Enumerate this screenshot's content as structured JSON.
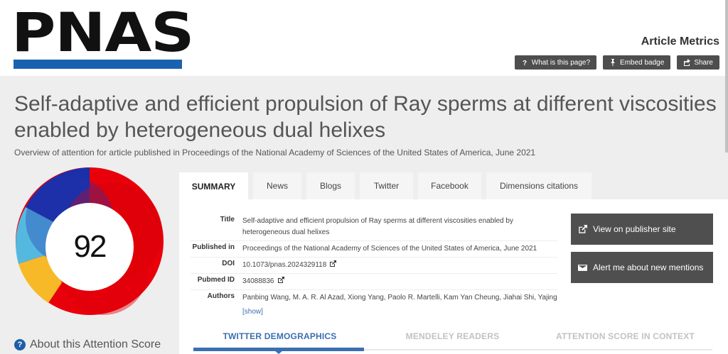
{
  "brand": {
    "logo_text": "PNAS",
    "accent": "#1a62b0"
  },
  "header": {
    "title": "Article Metrics",
    "buttons": [
      {
        "label": "What is this page?",
        "icon": "question-icon"
      },
      {
        "label": "Embed badge",
        "icon": "pin-icon"
      },
      {
        "label": "Share",
        "icon": "share-icon"
      }
    ]
  },
  "article": {
    "title": "Self-adaptive and efficient propulsion of Ray sperms at different viscosities enabled by heterogeneous dual helixes",
    "subtitle": "Overview of attention for article published in Proceedings of the National Academy of Sciences of the United States of America, June 2021"
  },
  "attention": {
    "score": "92",
    "about_label": "About this Attention Score",
    "donut_colors": [
      "#e8000b",
      "#1b2fa8",
      "#f7b928",
      "#55b9df"
    ]
  },
  "tabs": [
    {
      "label": "SUMMARY",
      "active": true
    },
    {
      "label": "News"
    },
    {
      "label": "Blogs"
    },
    {
      "label": "Twitter"
    },
    {
      "label": "Facebook"
    },
    {
      "label": "Dimensions citations"
    }
  ],
  "details": {
    "title_label": "Title",
    "title_value": "Self-adaptive and efficient propulsion of Ray sperms at different viscosities enabled by heterogeneous dual helixes",
    "published_label": "Published in",
    "published_value": "Proceedings of the National Academy of Sciences of the United States of America, June 2021",
    "doi_label": "DOI",
    "doi_value": "10.1073/pnas.2024329118",
    "pubmed_label": "Pubmed ID",
    "pubmed_value": "34088836",
    "authors_label": "Authors",
    "authors_value": "Panbing Wang, M. A. R. Al Azad, Xiong Yang, Paolo R. Martelli, Kam Yan Cheung, Jiahai Shi, Yajing…",
    "show_label": "[show]"
  },
  "actions": {
    "publisher": "View on publisher site",
    "alert": "Alert me about new mentions"
  },
  "subtabs": [
    {
      "label": "TWITTER DEMOGRAPHICS",
      "active": true
    },
    {
      "label": "MENDELEY READERS"
    },
    {
      "label": "ATTENTION SCORE IN CONTEXT"
    }
  ]
}
